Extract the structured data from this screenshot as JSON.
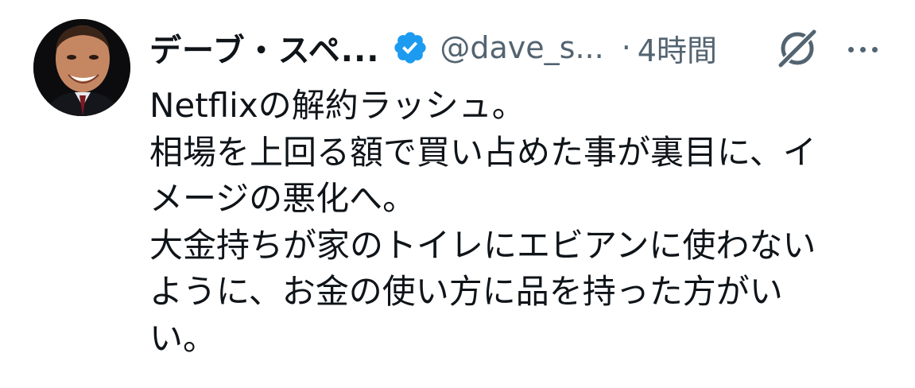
{
  "tweet": {
    "display_name": "デーブ・スペ...",
    "handle": "@dave_s...",
    "separator": "·",
    "time": "4時間",
    "lines": [
      "Netflixの解約ラッシュ。",
      "相場を上回る額で買い占めた事が裏目に、イ",
      "メージの悪化へ。",
      "大金持ちが家のトイレにエビアンに使わない",
      "ように、お金の使い方に品を持った方がい",
      "い。"
    ]
  },
  "icons": {
    "verified": "verified-badge-icon",
    "grok": "grok-icon",
    "more": "more-options-icon"
  },
  "colors": {
    "text": "#0f1419",
    "secondary": "#536471",
    "verified": "#1d9bf0"
  }
}
